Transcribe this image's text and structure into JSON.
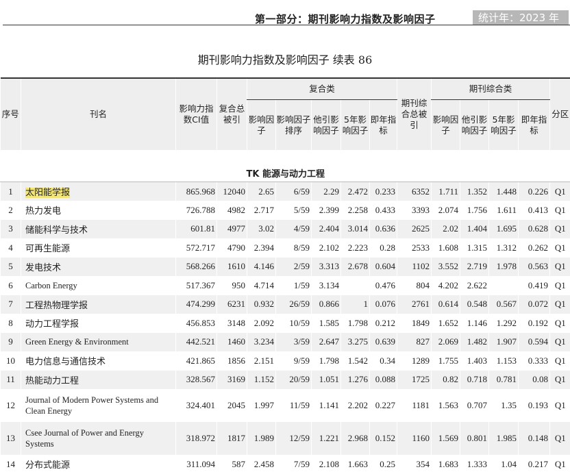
{
  "header": {
    "title": "第一部分：期刊影响力指数及影响因子",
    "year": "统计年：2023 年"
  },
  "table_title": "期刊影响力指数及影响因子  续表 86",
  "columns": {
    "no": "序号",
    "name": "刊名",
    "ci": "影响力指数CI值",
    "fuhe_total": "复合总被引",
    "fuhe_group": "复合类",
    "f_if": "影响因子",
    "f_rank": "影响因子排序",
    "f_other": "他引影响因子",
    "f_5y": "5年影响因子",
    "f_imm": "即年指标",
    "zonghe_total": "期刊综合总被引",
    "zonghe_group": "期刊综合类",
    "z_if": "影响因子",
    "z_other": "他引影响因子",
    "z_5y": "5年影响因子",
    "z_imm": "即年指标",
    "zone": "分区"
  },
  "section": "TK  能源与动力工程",
  "rows": [
    {
      "no": "1",
      "name": "太阳能学报",
      "ci": "865.968",
      "ft": "12040",
      "fif": "2.65",
      "fr": "6/59",
      "fo": "2.29",
      "f5": "2.472",
      "fi": "0.233",
      "zt": "6352",
      "zif": "1.711",
      "zo": "1.352",
      "z5": "1.448",
      "zi": "0.226",
      "zone": "Q1"
    },
    {
      "no": "2",
      "name": "热力发电",
      "ci": "726.788",
      "ft": "4982",
      "fif": "2.717",
      "fr": "5/59",
      "fo": "2.399",
      "f5": "2.258",
      "fi": "0.433",
      "zt": "3393",
      "zif": "2.074",
      "zo": "1.756",
      "z5": "1.611",
      "zi": "0.413",
      "zone": "Q1"
    },
    {
      "no": "3",
      "name": "储能科学与技术",
      "ci": "601.81",
      "ft": "4977",
      "fif": "3.02",
      "fr": "4/59",
      "fo": "2.404",
      "f5": "3.014",
      "fi": "0.636",
      "zt": "2625",
      "zif": "2.02",
      "zo": "1.404",
      "z5": "1.695",
      "zi": "0.628",
      "zone": "Q1"
    },
    {
      "no": "4",
      "name": "可再生能源",
      "ci": "572.717",
      "ft": "4790",
      "fif": "2.394",
      "fr": "8/59",
      "fo": "2.102",
      "f5": "2.223",
      "fi": "0.28",
      "zt": "2533",
      "zif": "1.608",
      "zo": "1.315",
      "z5": "1.312",
      "zi": "0.262",
      "zone": "Q1"
    },
    {
      "no": "5",
      "name": "发电技术",
      "ci": "568.266",
      "ft": "1610",
      "fif": "4.146",
      "fr": "2/59",
      "fo": "3.313",
      "f5": "2.678",
      "fi": "0.604",
      "zt": "1102",
      "zif": "3.552",
      "zo": "2.719",
      "z5": "1.978",
      "zi": "0.563",
      "zone": "Q1"
    },
    {
      "no": "6",
      "name": "Carbon Energy",
      "ci": "517.367",
      "ft": "950",
      "fif": "4.714",
      "fr": "1/59",
      "fo": "3.134",
      "f5": "",
      "fi": "0.476",
      "zt": "804",
      "zif": "4.202",
      "zo": "2.622",
      "z5": "",
      "zi": "0.419",
      "zone": "Q1"
    },
    {
      "no": "7",
      "name": "工程热物理学报",
      "ci": "474.299",
      "ft": "6231",
      "fif": "0.932",
      "fr": "26/59",
      "fo": "0.866",
      "f5": "1",
      "fi": "0.076",
      "zt": "2761",
      "zif": "0.614",
      "zo": "0.548",
      "z5": "0.567",
      "zi": "0.072",
      "zone": "Q1"
    },
    {
      "no": "8",
      "name": "动力工程学报",
      "ci": "456.853",
      "ft": "3148",
      "fif": "2.092",
      "fr": "10/59",
      "fo": "1.585",
      "f5": "1.798",
      "fi": "0.212",
      "zt": "1849",
      "zif": "1.652",
      "zo": "1.146",
      "z5": "1.292",
      "zi": "0.192",
      "zone": "Q1"
    },
    {
      "no": "9",
      "name": "Green Energy & Environment",
      "ci": "442.521",
      "ft": "1460",
      "fif": "3.234",
      "fr": "3/59",
      "fo": "2.647",
      "f5": "3.275",
      "fi": "0.639",
      "zt": "827",
      "zif": "2.069",
      "zo": "1.482",
      "z5": "1.907",
      "zi": "0.594",
      "zone": "Q1"
    },
    {
      "no": "10",
      "name": "电力信息与通信技术",
      "ci": "421.865",
      "ft": "1856",
      "fif": "2.151",
      "fr": "9/59",
      "fo": "1.798",
      "f5": "1.542",
      "fi": "0.34",
      "zt": "1289",
      "zif": "1.755",
      "zo": "1.403",
      "z5": "1.153",
      "zi": "0.333",
      "zone": "Q1"
    },
    {
      "no": "11",
      "name": "热能动力工程",
      "ci": "328.567",
      "ft": "3169",
      "fif": "1.152",
      "fr": "20/59",
      "fo": "1.051",
      "f5": "1.276",
      "fi": "0.088",
      "zt": "1725",
      "zif": "0.82",
      "zo": "0.718",
      "z5": "0.781",
      "zi": "0.08",
      "zone": "Q1"
    },
    {
      "no": "12",
      "name": "Journal of Modern Power Systems and Clean Energy",
      "ci": "324.401",
      "ft": "2045",
      "fif": "1.997",
      "fr": "11/59",
      "fo": "1.141",
      "f5": "2.202",
      "fi": "0.227",
      "zt": "1181",
      "zif": "1.563",
      "zo": "0.707",
      "z5": "1.35",
      "zi": "0.193",
      "zone": "Q1"
    },
    {
      "no": "13",
      "name": "Csee Journal of Power and Energy Systems",
      "ci": "318.972",
      "ft": "1817",
      "fif": "1.989",
      "fr": "12/59",
      "fo": "1.221",
      "f5": "2.968",
      "fi": "0.152",
      "zt": "1160",
      "zif": "1.569",
      "zo": "0.801",
      "z5": "1.985",
      "zi": "0.148",
      "zone": "Q1"
    },
    {
      "no": "14",
      "name": "分布式能源",
      "ci": "311.094",
      "ft": "587",
      "fif": "2.458",
      "fr": "7/59",
      "fo": "2.108",
      "f5": "1.663",
      "fi": "0.25",
      "zt": "354",
      "zif": "1.683",
      "zo": "1.333",
      "z5": "1.04",
      "zi": "0.217",
      "zone": "Q1"
    }
  ]
}
